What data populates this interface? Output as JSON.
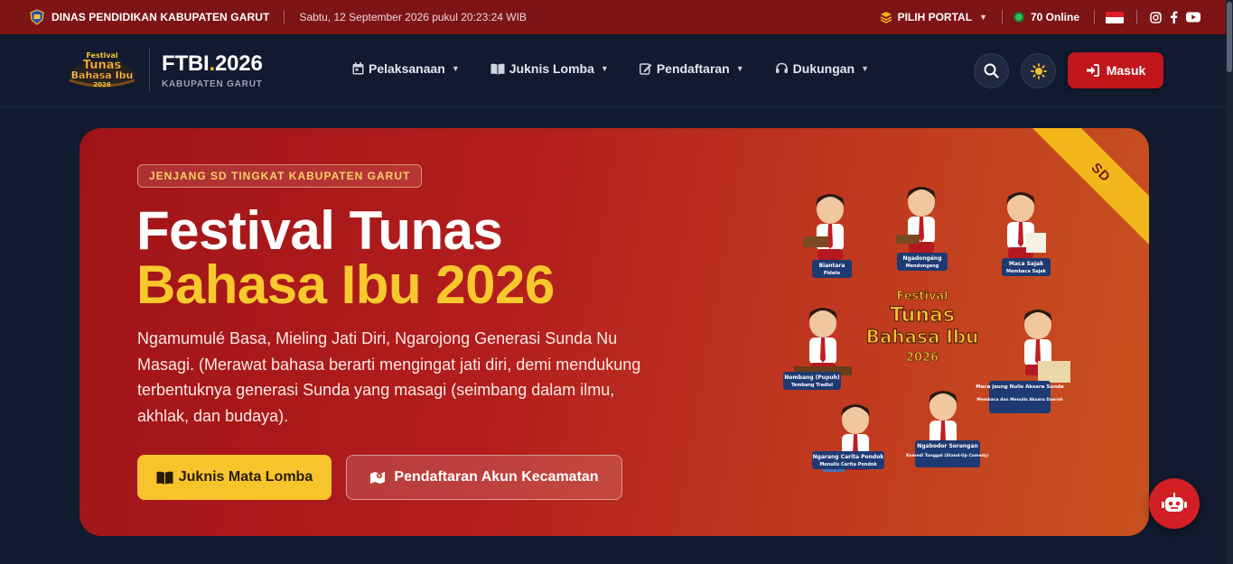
{
  "topbar": {
    "agency": "DINAS PENDIDIKAN KABUPATEN GARUT",
    "datetime": "Sabtu, 12 September 2026 pukul 20:23:24 WIB",
    "portal_label": "PILIH PORTAL",
    "online_label": "70 Online",
    "social": [
      "instagram-icon",
      "facebook-icon",
      "youtube-icon"
    ]
  },
  "brand": {
    "logo_text": [
      "Festival",
      "Tunas",
      "Bahasa Ibu",
      "2026"
    ],
    "title_a": "FTBI",
    "title_dot": ".",
    "title_b": "2026",
    "subtitle": "KABUPATEN GARUT"
  },
  "nav": {
    "items": [
      {
        "label": "Pelaksanaan",
        "icon": "calendar-icon"
      },
      {
        "label": "Juknis Lomba",
        "icon": "book-icon"
      },
      {
        "label": "Pendaftaran",
        "icon": "edit-icon"
      },
      {
        "label": "Dukungan",
        "icon": "headset-icon"
      }
    ],
    "login_label": "Masuk"
  },
  "hero": {
    "badge": "JENJANG SD TINGKAT KABUPATEN GARUT",
    "title_line1": "Festival Tunas",
    "title_line2": "Bahasa Ibu 2026",
    "description": "Ngamumulé Basa, Mieling Jati Diri, Ngarojong Generasi Sunda Nu Masagi. (Merawat bahasa berarti mengingat jati diri, demi mendukung terbentuknya generasi Sunda yang masagi (seimbang dalam ilmu, akhlak, dan budaya).",
    "btn_primary": "Juknis Mata Lomba",
    "btn_secondary": "Pendaftaran Akun Kecamatan",
    "ribbon": "SD"
  },
  "illustration": {
    "center_title": [
      "Festival",
      "Tunas",
      "Bahasa Ibu",
      "2026"
    ],
    "labels": [
      {
        "title": "Biantara",
        "sub": "Pidato"
      },
      {
        "title": "Ngadongéng",
        "sub": "Mendongeng"
      },
      {
        "title": "Maca Sajak",
        "sub": "Membaca Sajak"
      },
      {
        "title": "Nembang (Pupuh)",
        "sub": "Tembang Tradisi"
      },
      {
        "title": "Maca jeung Nulis Aksara Sunda",
        "sub": "Membaca dan Menulis Aksara Daerah"
      },
      {
        "title": "Ngarang Carita Pondok",
        "sub": "Menulis Cerita Pondok"
      },
      {
        "title": "Ngabodor Sorangan",
        "sub": "Komedi Tunggal (Stand-Up Comedy)"
      }
    ]
  },
  "colors": {
    "topbar_bg": "#7d1416",
    "page_bg": "#111a2e",
    "accent_yellow": "#f7c52b",
    "accent_red": "#c0161c"
  }
}
